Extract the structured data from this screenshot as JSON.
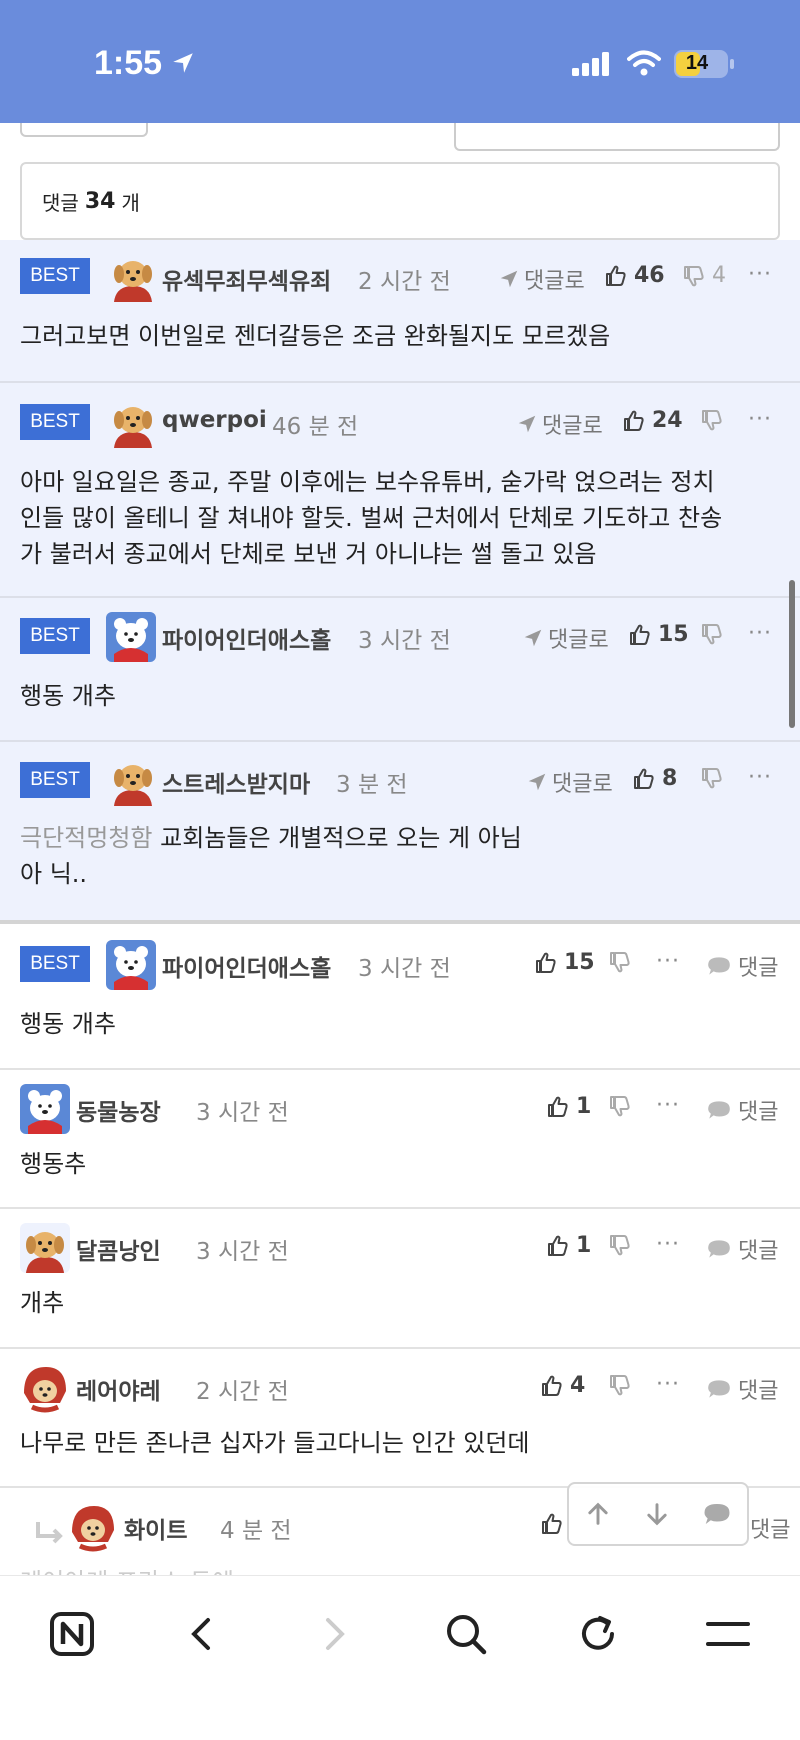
{
  "status": {
    "time": "1:55",
    "battery": "14"
  },
  "comment_count": {
    "prefix": "댓글",
    "count": "34",
    "suffix": "개"
  },
  "labels": {
    "best": "BEST",
    "reply_to": "댓글로",
    "reply": "댓글",
    "more": "···"
  },
  "best_comments": [
    {
      "nick": "유섹무죄무섹유죄",
      "time": "2 시간 전",
      "likes": "46",
      "dislikes": "4",
      "avatar": "puppy",
      "text": "그러고보면 이번일로 젠더갈등은 조금 완화될지도 모르겠음"
    },
    {
      "nick": "qwerpoi",
      "time": "46 분 전",
      "likes": "24",
      "dislikes": "",
      "avatar": "puppy",
      "text_lines": [
        "아마 일요일은 종교, 주말 이후에는 보수유튜버, 숟가락 얹으려는 정치",
        "인들 많이 올테니 잘 쳐내야 할듯. 벌써 근처에서 단체로 기도하고 찬송",
        "가 불러서 종교에서 단체로 보낸 거 아니냐는 썰 돌고 있음"
      ]
    },
    {
      "nick": "파이어인더애스홀",
      "time": "3 시간 전",
      "likes": "15",
      "dislikes": "",
      "avatar": "bear",
      "text": "행동 개추"
    },
    {
      "nick": "스트레스받지마",
      "time": "3 분 전",
      "likes": "8",
      "dislikes": "",
      "avatar": "puppy",
      "ref": "극단적멍청함",
      "text_line1": "교회놈들은 개별적으로 오는 게 아님",
      "text_line2": "아 닉.."
    }
  ],
  "comments": [
    {
      "best": true,
      "nick": "파이어인더애스홀",
      "time": "3 시간 전",
      "likes": "15",
      "avatar": "bear",
      "text": "행동 개추"
    },
    {
      "best": false,
      "nick": "동물농장",
      "time": "3 시간 전",
      "likes": "1",
      "avatar": "bear",
      "text": "행동추"
    },
    {
      "best": false,
      "nick": "달콤낭인",
      "time": "3 시간 전",
      "likes": "1",
      "avatar": "puppy",
      "text": "개추"
    },
    {
      "best": false,
      "nick": "레어야레",
      "time": "2 시간 전",
      "likes": "4",
      "avatar": "puppy-red",
      "text": "나무로 만든 존나큰 십자가 들고다니는 인간 있던데"
    },
    {
      "best": false,
      "reply": true,
      "nick": "화이트",
      "time": "4 분 전",
      "likes": "",
      "avatar": "puppy-red",
      "text": "레어야레 프라스 두에"
    }
  ],
  "colors": {
    "status_bar": "#6a8cdc",
    "best_bg": "#eef2fd",
    "best_badge": "#3d6fd6"
  },
  "icons": [
    "location-arrow-icon",
    "signal-icon",
    "wifi-icon",
    "battery-icon",
    "thumbs-up-icon",
    "thumbs-down-icon",
    "more-icon",
    "speech-bubble-icon",
    "naver-icon",
    "back-icon",
    "forward-icon",
    "search-icon",
    "reload-icon",
    "menu-icon"
  ]
}
